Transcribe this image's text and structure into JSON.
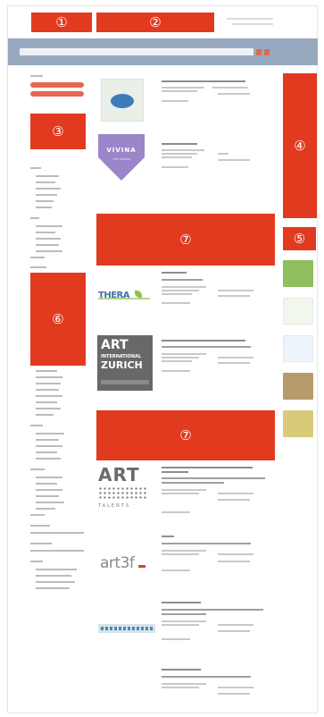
{
  "markers": {
    "m1": "①",
    "m2": "②",
    "m3": "③",
    "m4": "④",
    "m5": "⑤",
    "m6": "⑥",
    "m7a": "⑦",
    "m7b": "⑦"
  },
  "logos": {
    "vivina": "VIVINA",
    "vivina_sub": "THE LEISURE",
    "thera": "THERA",
    "art_zurich_1": "ART",
    "art_zurich_2": "INTERNATIONAL",
    "art_zurich_3": "ZURICH",
    "art_talents_1": "ART",
    "art_talents_2": "TALENTS",
    "art3f": "art3f"
  },
  "colors": {
    "marker": "#e13a1f",
    "search_bar": "#97a9be",
    "pill": "#e8664f"
  }
}
